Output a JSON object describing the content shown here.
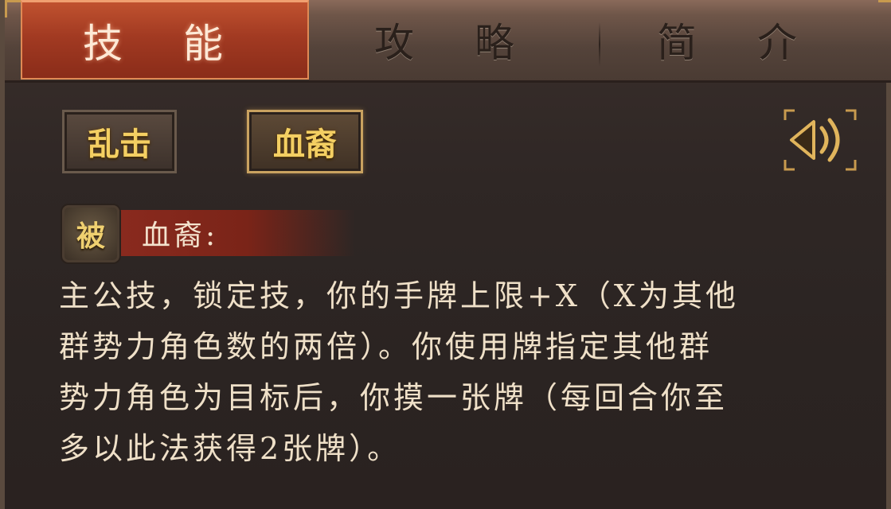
{
  "tabs": [
    {
      "label": "技 能",
      "active": true
    },
    {
      "label": "攻 略",
      "active": false
    },
    {
      "label": "简 介",
      "active": false
    }
  ],
  "skill_buttons": [
    {
      "label": "乱击",
      "selected": false
    },
    {
      "label": "血裔",
      "selected": true
    }
  ],
  "sound_button": {
    "icon": "speaker-icon"
  },
  "skill_detail": {
    "type_badge": "被",
    "title": "血裔:",
    "description_lines": [
      "主公技，锁定技，你的手牌上限+X（X为其他",
      "群势力角色数的两倍）。你使用牌指定其他群",
      "势力角色为目标后，你摸一张牌（每回合你至",
      "多以此法获得2张牌）。"
    ]
  },
  "colors": {
    "active_tab": "#a23a22",
    "gold_text": "#f4cf62",
    "body_text": "#efe0c8",
    "title_bar": "#8a2a1e"
  }
}
